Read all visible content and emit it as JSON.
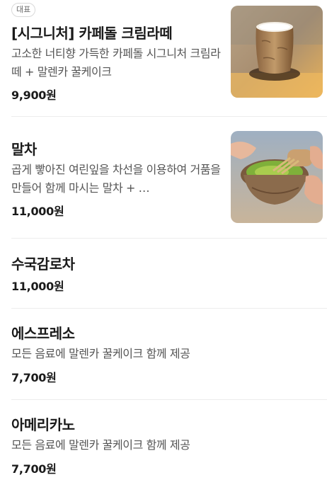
{
  "menu": {
    "items": [
      {
        "badge": "대표",
        "name": "[시그니처] 카페돌 크림라떼",
        "description": "고소한 너티향 가득한 카페돌 시그니처 크림라떼 + 말렌카 꿀케이크",
        "price": "9,900원",
        "image_icon": "cream-latte-photo"
      },
      {
        "name": "말차",
        "description": "곱게 빻아진 여린잎을 차선을 이용하여 거품을 만들어 함께 마시는 말차 + …",
        "price": "11,000원",
        "image_icon": "matcha-whisk-photo"
      },
      {
        "name": "수국감로차",
        "price": "11,000원"
      },
      {
        "name": "에스프레소",
        "description": "모든 음료에 말렌카 꿀케이크 함께 제공",
        "price": "7,700원"
      },
      {
        "name": "아메리카노",
        "description": "모든 음료에 말렌카 꿀케이크 함께 제공",
        "price": "7,700원"
      }
    ]
  }
}
